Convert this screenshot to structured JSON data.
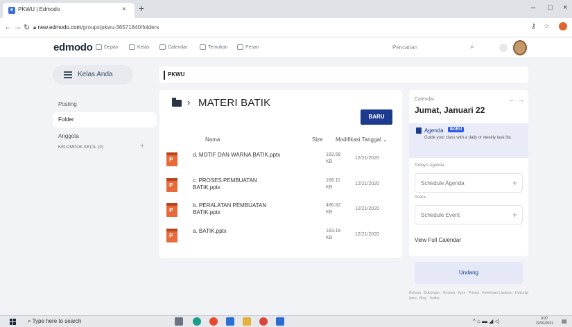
{
  "browser": {
    "tab_title": "PKWU | Edmodo",
    "tab_close": "×",
    "new_tab": "+",
    "url_host": "new.edmodo.com",
    "url_path": "/groups/pkwu-36571840/folders",
    "win_min": "–",
    "win_max": "□",
    "win_close": "×"
  },
  "header": {
    "logo": "edmodo",
    "nav": [
      "Depan",
      "Kelas",
      "Calendar",
      "Temukan",
      "Pesan"
    ],
    "search_placeholder": "Pencarian"
  },
  "sidebar": {
    "kelas_button": "Kelas Anda",
    "items": [
      "Posting",
      "Folder",
      "Anggota"
    ],
    "subgroup": "KELOMPOK KECIL (0)",
    "subgroup_add": "+"
  },
  "breadcrumb": "PKWU",
  "folder": {
    "title": "MATERI BATIK",
    "new_button": "BARU",
    "columns": {
      "name": "Nama",
      "size": "Size",
      "modified": "Modifikasi Tanggal ⌄"
    },
    "files": [
      {
        "name": "d. MOTIF DAN WARNA BATIK.pptx",
        "size": "183.58 KB",
        "date": "12/21/2020"
      },
      {
        "name": "c. PROSES PEMBUATAN BATIK.pptx",
        "size": "188.11 KB",
        "date": "12/21/2020"
      },
      {
        "name": "b. PERALATAN PEMBUATAN BATIK.pptx",
        "size": "486.82 KB",
        "date": "12/21/2020"
      },
      {
        "name": "a. BATIK.pptx",
        "size": "183.18 KB",
        "date": "12/21/2020"
      }
    ]
  },
  "calendar": {
    "label": "Calendar",
    "date": "Jumat, Januari 22",
    "agenda_title": "Agenda",
    "agenda_badge": "BARU",
    "agenda_desc": "Guide your class with a daily or weekly task list.",
    "todays_agenda": "Today's Agenda",
    "schedule_agenda": "Schedule Agenda",
    "acara": "Acara",
    "schedule_event": "Schedule Event",
    "view_full": "View Full Calendar"
  },
  "invite_button": "Undang",
  "footer_links": "Bahasa · Dukungan · Tentang · Karir · Privasi · Ketentuan Layanan · Hubungi kami · Blog · Twitter",
  "taskbar": {
    "search_placeholder": "Type here to search",
    "time": "9:37",
    "date": "22/01/2021"
  }
}
